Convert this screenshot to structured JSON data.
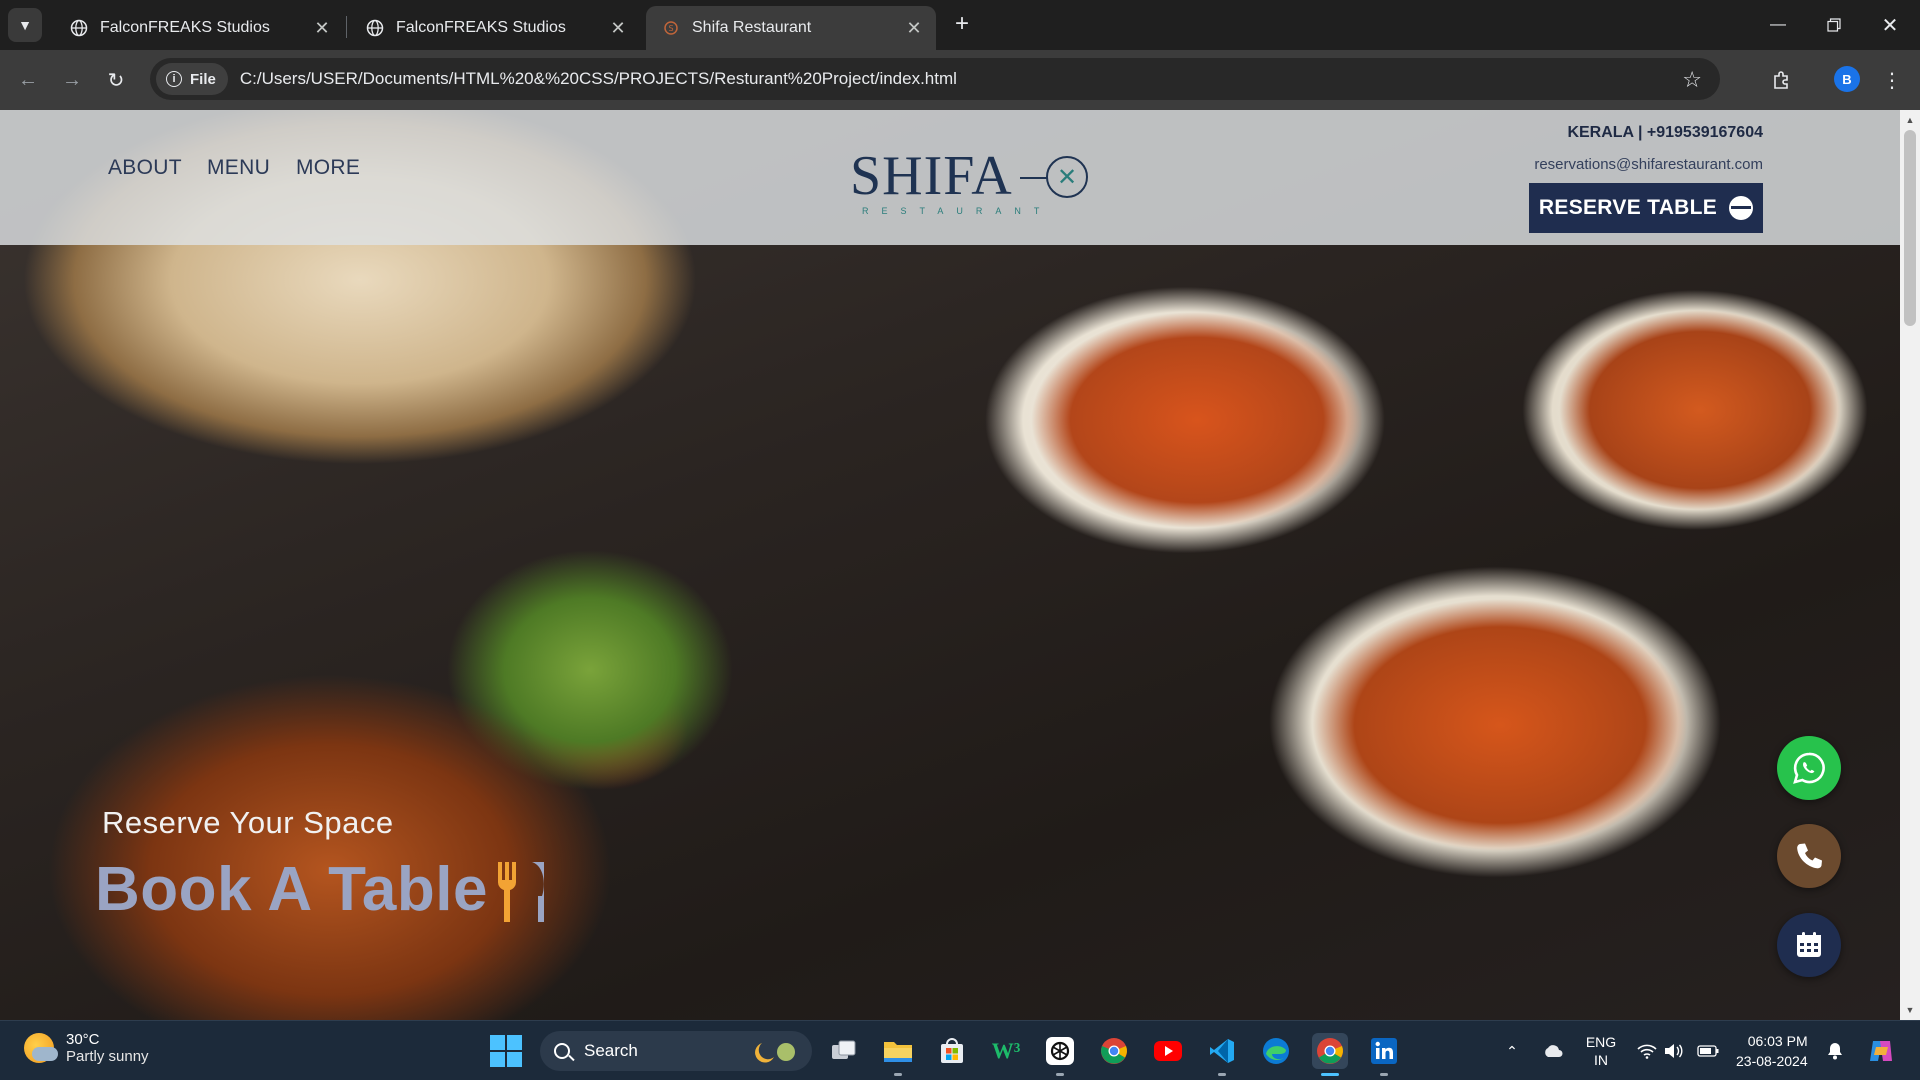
{
  "browser": {
    "tabs": [
      {
        "title": "FalconFREAKS Studios",
        "active": false
      },
      {
        "title": "FalconFREAKS Studios",
        "active": false
      },
      {
        "title": "Shifa Restaurant",
        "active": true
      }
    ],
    "address": {
      "scheme_chip": "File",
      "url": "C:/Users/USER/Documents/HTML%20&%20CSS/PROJECTS/Resturant%20Project/index.html"
    },
    "profile_initial": "B"
  },
  "site": {
    "nav": {
      "about": "ABOUT",
      "menu": "MENU",
      "more": "MORE"
    },
    "logo": {
      "word": "SHIFA",
      "sub": "RESTAURANT"
    },
    "contact": {
      "location_phone": "KERALA | +919539167604",
      "email": "reservations@shifarestaurant.com"
    },
    "reserve_button": "RESERVE TABLE",
    "hero": {
      "subtitle": "Reserve Your Space",
      "title": "Book A Table"
    },
    "fab": {
      "whatsapp_color": "#27c24c",
      "phone_color": "#6b4a2e",
      "calendar_color": "#1f2d4f"
    }
  },
  "taskbar": {
    "weather": {
      "temp": "30°C",
      "condition": "Partly sunny"
    },
    "search_placeholder": "Search",
    "language": {
      "lang": "ENG",
      "region": "IN"
    },
    "time": "06:03 PM",
    "date": "23-08-2024"
  },
  "colors": {
    "nav_text": "#2c3a57",
    "brand_navy": "#1f2d4f",
    "hero_title": "#9aa4c3"
  }
}
